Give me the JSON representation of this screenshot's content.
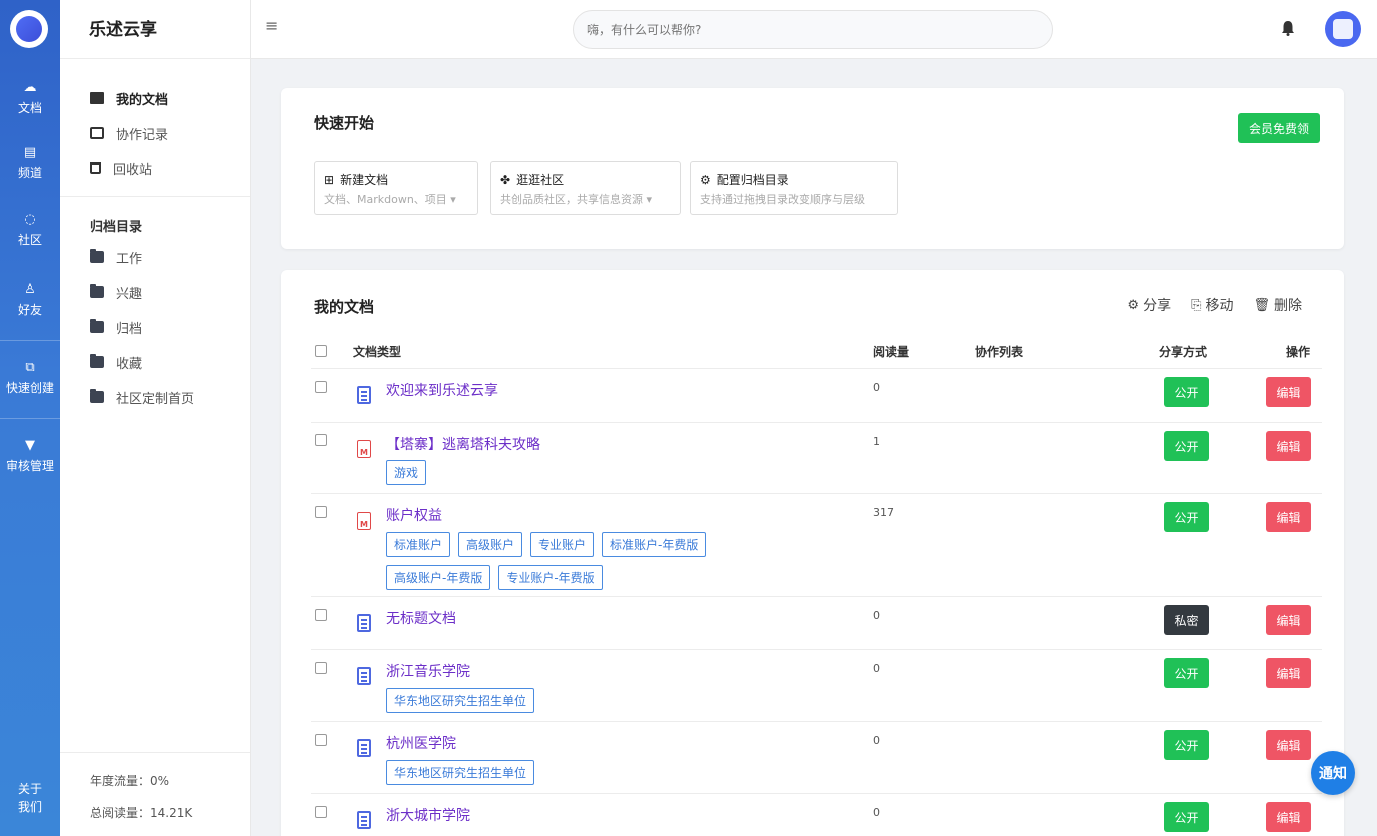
{
  "rail": {
    "items": [
      {
        "label": "文档",
        "icon": "cloud-icon"
      },
      {
        "label": "频道",
        "icon": "inbox-icon"
      },
      {
        "label": "社区",
        "icon": "planet-icon"
      },
      {
        "label": "好友",
        "icon": "users-icon"
      },
      {
        "label": "快速创建",
        "icon": "copy-plus-icon"
      },
      {
        "label": "审核管理",
        "icon": "filter-icon"
      }
    ],
    "about_line1": "关于",
    "about_line2": "我们"
  },
  "sidebar": {
    "brand": "乐述云享",
    "items": [
      {
        "label": "我的文档",
        "icon": "book-icon"
      },
      {
        "label": "协作记录",
        "icon": "clone-icon"
      },
      {
        "label": "回收站",
        "icon": "trash-icon"
      }
    ],
    "archive_heading": "归档目录",
    "folders": [
      {
        "label": "工作"
      },
      {
        "label": "兴趣"
      },
      {
        "label": "归档"
      },
      {
        "label": "收藏"
      },
      {
        "label": "社区定制首页"
      }
    ],
    "annual_traffic": "年度流量：0%",
    "total_reads": "总阅读量：14.21K"
  },
  "topbar": {
    "search_placeholder": "嗨，有什么可以帮你?"
  },
  "quickstart": {
    "title": "快速开始",
    "vip_button": "会员免费领",
    "cards": [
      {
        "title": "新建文档",
        "subtitle": "文档、Markdown、项目 ▾",
        "icon": "plus-square-icon"
      },
      {
        "title": "逛逛社区",
        "subtitle": "共创品质社区，共享信息资源 ▾",
        "icon": "clover-icon"
      },
      {
        "title": "配置归档目录",
        "subtitle": "支持通过拖拽目录改变顺序与层级",
        "icon": "gear-icon"
      }
    ]
  },
  "docs": {
    "title": "我的文档",
    "actions": {
      "share": "分享",
      "move": "移动",
      "delete": "删除"
    },
    "columns": {
      "type": "文档类型",
      "reads": "阅读量",
      "collab": "协作列表",
      "share": "分享方式",
      "ops": "操作"
    },
    "edit_label": "编辑",
    "rows": [
      {
        "title": "欢迎来到乐述云享",
        "kind": "doc",
        "reads": "0",
        "share": "公开",
        "tags": []
      },
      {
        "title": "【塔寨】逃离塔科夫攻略",
        "kind": "md",
        "reads": "1",
        "share": "公开",
        "tags": [
          "游戏"
        ]
      },
      {
        "title": "账户权益",
        "kind": "md",
        "reads": "317",
        "share": "公开",
        "tags": [
          "标准账户",
          "高级账户",
          "专业账户",
          "标准账户-年费版",
          "高级账户-年费版",
          "专业账户-年费版"
        ]
      },
      {
        "title": "无标题文档",
        "kind": "doc",
        "reads": "0",
        "share": "私密",
        "tags": []
      },
      {
        "title": "浙江音乐学院",
        "kind": "doc",
        "reads": "0",
        "share": "公开",
        "tags": [
          "华东地区研究生招生单位"
        ]
      },
      {
        "title": "杭州医学院",
        "kind": "doc",
        "reads": "0",
        "share": "公开",
        "tags": [
          "华东地区研究生招生单位"
        ]
      },
      {
        "title": "浙大城市学院",
        "kind": "doc",
        "reads": "0",
        "share": "公开",
        "tags": []
      }
    ]
  },
  "notify_label": "通知",
  "colors": {
    "primary": "#3a7ad6",
    "green": "#20c157",
    "red": "#ef5565",
    "title_purple": "#6c2fc8"
  }
}
